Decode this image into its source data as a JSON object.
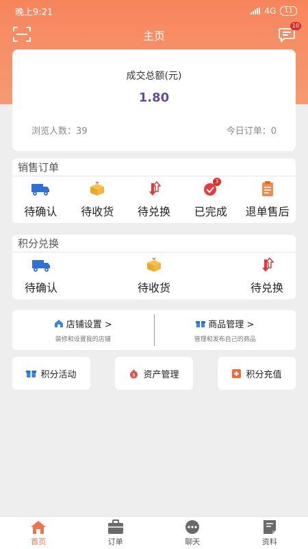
{
  "status_bar": {
    "time": "晚上9:21",
    "network": "4G",
    "battery": "11"
  },
  "header": {
    "title": "主页",
    "message_badge": "10"
  },
  "summary": {
    "title": "成交总额(元)",
    "amount": "1.80",
    "views": "浏览人数：39",
    "today_orders": "今日订单：0"
  },
  "sales_orders": {
    "title": "销售订单",
    "items": [
      {
        "label": "待确认",
        "icon": "truck-icon"
      },
      {
        "label": "待收货",
        "icon": "package-icon"
      },
      {
        "label": "待兑换",
        "icon": "exchange-arrows-icon"
      },
      {
        "label": "已完成",
        "icon": "check-circle-icon",
        "badge": "3"
      },
      {
        "label": "退单售后",
        "icon": "clipboard-icon"
      }
    ]
  },
  "points_exchange": {
    "title": "积分兑换",
    "items": [
      {
        "label": "待确认",
        "icon": "truck-icon"
      },
      {
        "label": "待收货",
        "icon": "package-icon"
      },
      {
        "label": "待兑换",
        "icon": "exchange-arrows-icon"
      }
    ]
  },
  "management": {
    "store": {
      "title": "店铺设置 >",
      "subtitle": "装修和设置我的店铺"
    },
    "goods": {
      "title": "商品管理 >",
      "subtitle": "管理和发布自己的商品"
    }
  },
  "quick_actions": [
    {
      "label": "积分活动",
      "icon": "gift-icon"
    },
    {
      "label": "资产管理",
      "icon": "money-bag-icon"
    },
    {
      "label": "积分充值",
      "icon": "plus-box-icon"
    }
  ],
  "tabs": [
    {
      "label": "首页",
      "icon": "home-icon",
      "active": true
    },
    {
      "label": "订单",
      "icon": "briefcase-icon"
    },
    {
      "label": "聊天",
      "icon": "chat-icon"
    },
    {
      "label": "资料",
      "icon": "document-icon"
    }
  ],
  "colors": {
    "brand": "#f7855c",
    "amount": "#6a4a9c",
    "badge": "#e02b2b"
  }
}
